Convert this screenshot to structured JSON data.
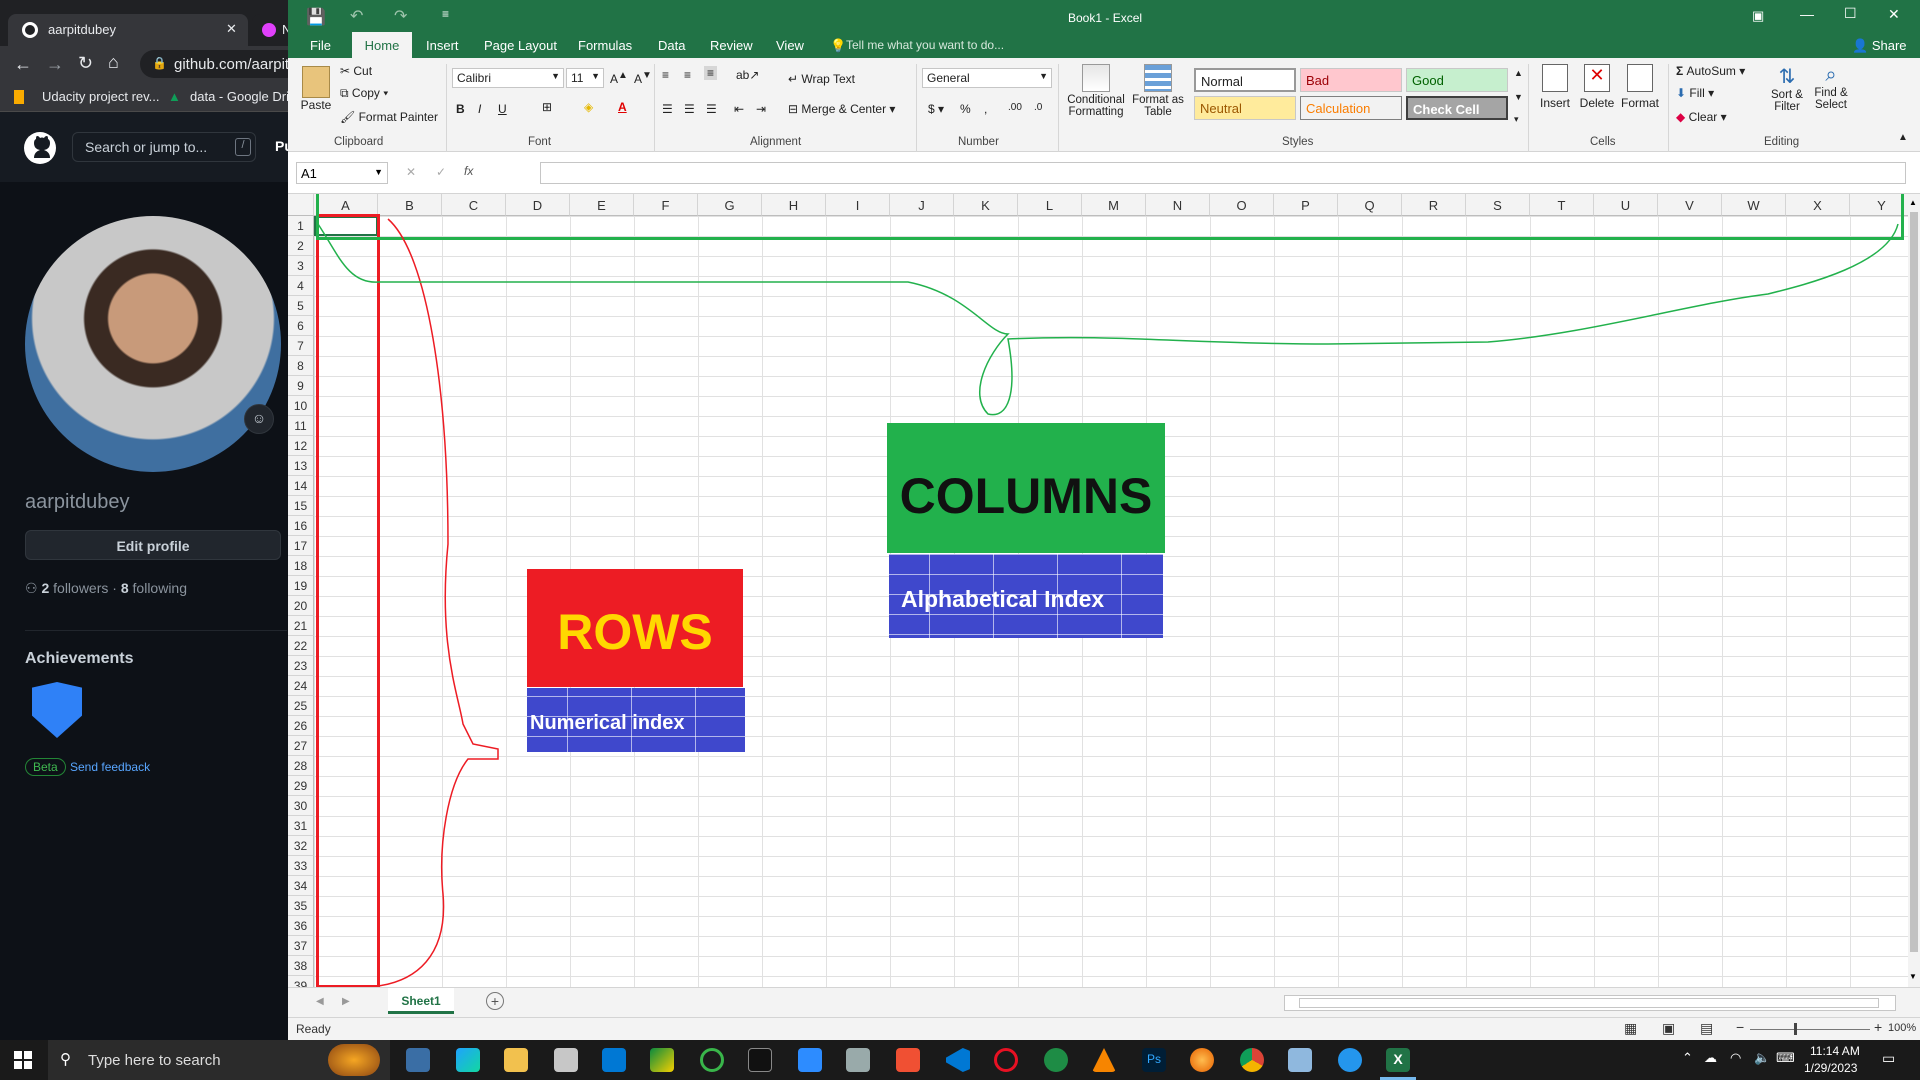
{
  "browser": {
    "tabs": [
      {
        "label": "aarpitdubey",
        "close": "✕"
      },
      {
        "label": "N"
      }
    ],
    "url": "github.com/aarpit",
    "bookmarks": [
      "Udacity project rev...",
      "data - Google Drive"
    ],
    "search_placeholder": "Search or jump to...",
    "search_shortcut": "/",
    "nav_partial": "Pu",
    "username": "aarpitdubey",
    "edit_profile": "Edit profile",
    "followers_count": "2",
    "followers_label": "followers",
    "following_count": "8",
    "following_label": "following",
    "achievements_title": "Achievements",
    "beta_badge": "Beta",
    "send_feedback": "Send feedback"
  },
  "excel": {
    "title": "Book1 - Excel",
    "share": "Share",
    "tabs": [
      "File",
      "Home",
      "Insert",
      "Page Layout",
      "Formulas",
      "Data",
      "Review",
      "View"
    ],
    "tell_me": "Tell me what you want to do...",
    "ribbon": {
      "clipboard": {
        "paste": "Paste",
        "cut": "Cut",
        "copy": "Copy",
        "format_painter": "Format Painter",
        "label": "Clipboard"
      },
      "font": {
        "name": "Calibri",
        "size": "11",
        "label": "Font"
      },
      "alignment": {
        "wrap": "Wrap Text",
        "merge": "Merge & Center",
        "label": "Alignment"
      },
      "number": {
        "format": "General",
        "label": "Number"
      },
      "styles": {
        "conditional": [
          "Conditional",
          "Formatting"
        ],
        "format_table": [
          "Format as",
          "Table"
        ],
        "normal": "Normal",
        "bad": "Bad",
        "good": "Good",
        "neutral": "Neutral",
        "calculation": "Calculation",
        "check_cell": "Check Cell",
        "label": "Styles"
      },
      "cells": {
        "insert": "Insert",
        "delete": "Delete",
        "format": "Format",
        "label": "Cells"
      },
      "editing": {
        "autosum": "AutoSum",
        "fill": "Fill",
        "clear": "Clear",
        "sort": [
          "Sort &",
          "Filter"
        ],
        "find": [
          "Find &",
          "Select"
        ],
        "label": "Editing"
      }
    },
    "name_box": "A1",
    "fx": "fx",
    "columns": [
      "A",
      "B",
      "C",
      "D",
      "E",
      "F",
      "G",
      "H",
      "I",
      "J",
      "K",
      "L",
      "M",
      "N",
      "O",
      "P",
      "Q",
      "R",
      "S",
      "T",
      "U",
      "V",
      "W",
      "X",
      "Y"
    ],
    "rows": [
      "1",
      "2",
      "3",
      "4",
      "5",
      "6",
      "7",
      "8",
      "9",
      "10",
      "11",
      "12",
      "13",
      "14",
      "15",
      "16",
      "17",
      "18",
      "19",
      "20",
      "21",
      "22",
      "23",
      "24",
      "25",
      "26",
      "27",
      "28",
      "29",
      "30",
      "31",
      "32",
      "33",
      "34",
      "35",
      "36",
      "37",
      "38",
      "39"
    ],
    "annotations": {
      "columns_title": "COLUMNS",
      "columns_sub": "Alphabetical Index",
      "rows_title": "ROWS",
      "rows_sub": "Numerical index"
    },
    "sheet_tab": "Sheet1",
    "status": "Ready",
    "zoom": "100%",
    "colors": {
      "excel_green": "#217346",
      "rows_red": "#ed1c24",
      "columns_green": "#22b14c",
      "index_blue": "#3f48cc"
    }
  },
  "taskbar": {
    "search_placeholder": "Type here to search",
    "time": "11:14 AM",
    "date": "1/29/2023"
  }
}
